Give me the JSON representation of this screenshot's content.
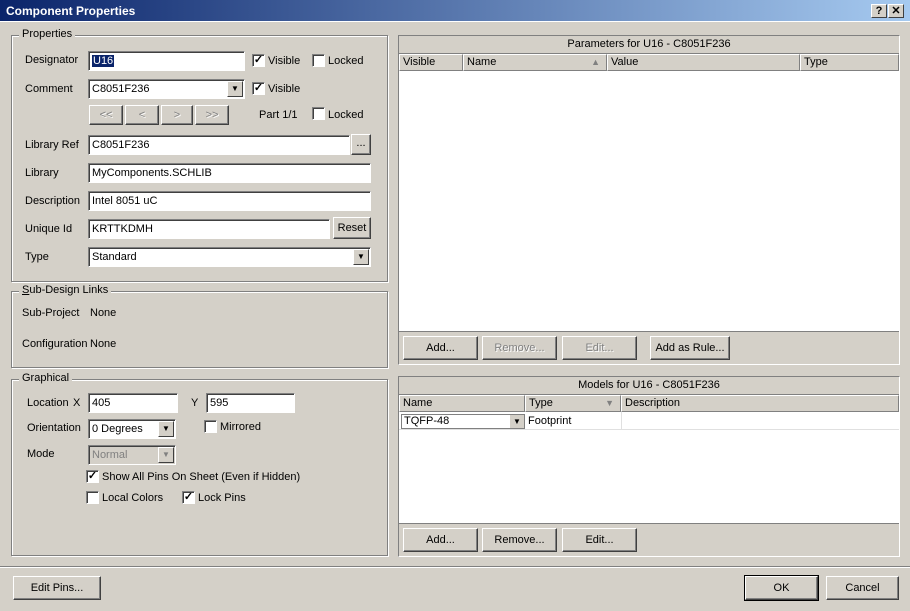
{
  "window": {
    "title": "Component Properties",
    "help_label": "?",
    "close_label": "✕"
  },
  "properties": {
    "group_label": "Properties",
    "designator": {
      "label": "Designator",
      "value": "U16",
      "visible_label": "Visible",
      "visible": true,
      "locked_label": "Locked",
      "locked": false
    },
    "comment": {
      "label": "Comment",
      "value": "C8051F236",
      "visible_label": "Visible",
      "visible": true
    },
    "nav": {
      "first": "<<",
      "prev": "<",
      "next": ">",
      "last": ">>"
    },
    "part": {
      "label": "Part 1/1",
      "locked_label": "Locked",
      "locked": false
    },
    "library_ref": {
      "label": "Library Ref",
      "value": "C8051F236",
      "browse_label": "..."
    },
    "library": {
      "label": "Library",
      "value": "MyComponents.SCHLIB"
    },
    "description": {
      "label": "Description",
      "value": "Intel 8051 uC"
    },
    "unique_id": {
      "label": "Unique Id",
      "value": "KRTTKDMH",
      "reset_label": "Reset"
    },
    "type": {
      "label": "Type",
      "value": "Standard"
    }
  },
  "sub_design": {
    "group_label": "Sub-Design Links",
    "sub_project_label": "Sub-Project",
    "sub_project_value": "None",
    "configuration_label": "Configuration",
    "configuration_value": "None"
  },
  "graphical": {
    "group_label": "Graphical",
    "location_label": "Location",
    "x_label": "X",
    "x_value": "405",
    "y_label": "Y",
    "y_value": "595",
    "orientation_label": "Orientation",
    "orientation_value": "0 Degrees",
    "mirrored_label": "Mirrored",
    "mirrored": false,
    "mode_label": "Mode",
    "mode_value": "Normal",
    "show_all_pins_label": "Show All Pins On Sheet (Even if Hidden)",
    "show_all_pins": true,
    "local_colors_label": "Local Colors",
    "local_colors": false,
    "lock_pins_label": "Lock Pins",
    "lock_pins": true
  },
  "parameters": {
    "title": "Parameters for U16 - C8051F236",
    "columns": [
      "Visible",
      "Name",
      "Value",
      "Type"
    ],
    "buttons": {
      "add": "Add...",
      "remove": "Remove...",
      "edit": "Edit...",
      "add_rule": "Add as Rule..."
    }
  },
  "models": {
    "title": "Models for U16 - C8051F236",
    "columns": [
      "Name",
      "Type",
      "Description"
    ],
    "rows": [
      {
        "name": "TQFP-48",
        "type": "Footprint",
        "description": ""
      }
    ],
    "buttons": {
      "add": "Add...",
      "remove": "Remove...",
      "edit": "Edit..."
    }
  },
  "footer": {
    "edit_pins": "Edit Pins...",
    "ok": "OK",
    "cancel": "Cancel"
  }
}
